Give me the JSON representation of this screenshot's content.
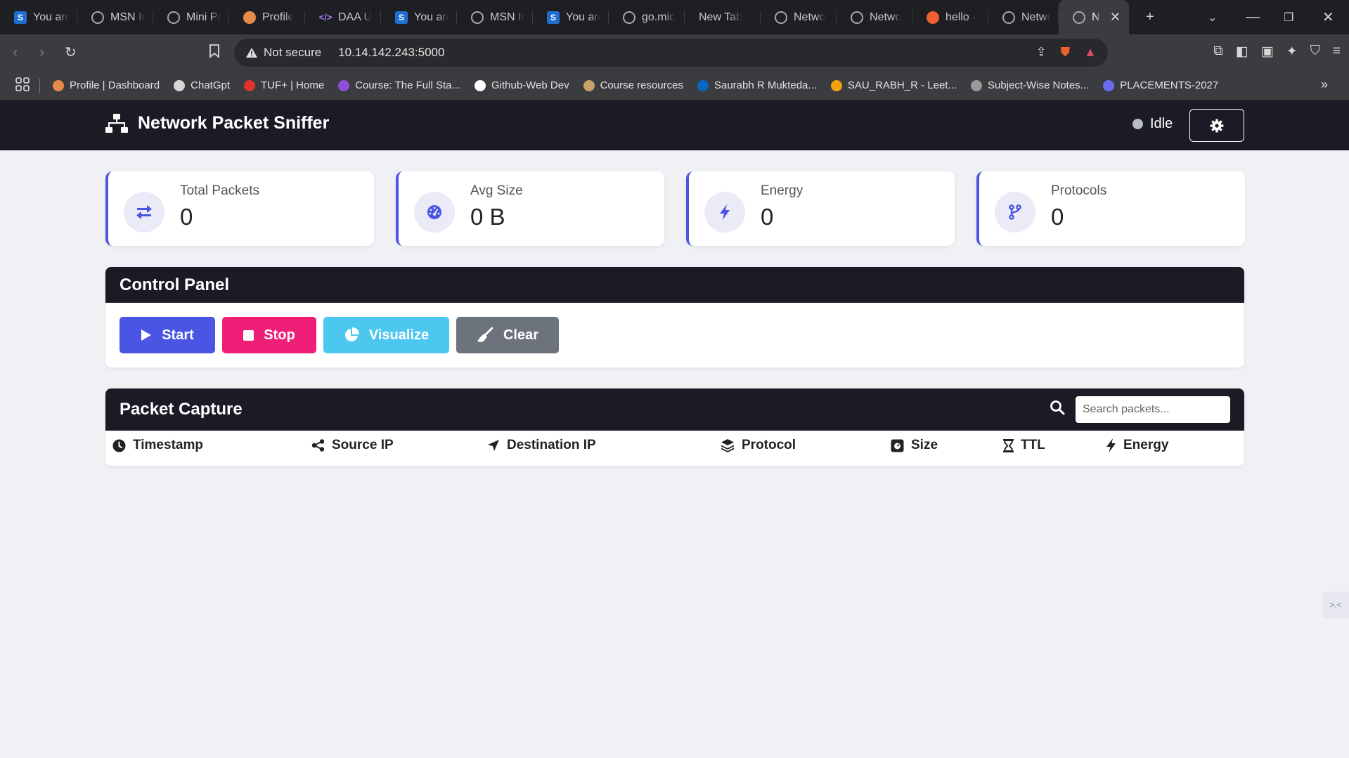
{
  "browser": {
    "tabs": [
      {
        "label": "You are",
        "icon": "s-logo-icon",
        "fav": "s",
        "glyph": "S",
        "w": 110
      },
      {
        "label": "MSN Ir",
        "icon": "globe-icon",
        "fav": "globe",
        "glyph": "",
        "w": 108
      },
      {
        "label": "Mini Pr",
        "icon": "openai-icon",
        "fav": "globe",
        "glyph": "",
        "w": 108
      },
      {
        "label": "Profile",
        "icon": "profile-icon",
        "fav": "orange",
        "glyph": "",
        "w": 108
      },
      {
        "label": "DAA U",
        "icon": "code-icon",
        "fav": "code",
        "glyph": "</>",
        "w": 108
      },
      {
        "label": "You are",
        "icon": "s-logo-icon",
        "fav": "s",
        "glyph": "S",
        "w": 108
      },
      {
        "label": "MSN Ir",
        "icon": "globe-icon",
        "fav": "globe",
        "glyph": "",
        "w": 108
      },
      {
        "label": "You are",
        "icon": "s-logo-icon",
        "fav": "s",
        "glyph": "S",
        "w": 108
      },
      {
        "label": "go.mic",
        "icon": "globe-icon",
        "fav": "globe",
        "glyph": "",
        "w": 108
      },
      {
        "label": "New Tab",
        "icon": "",
        "fav": "",
        "glyph": "",
        "w": 108
      },
      {
        "label": "Netwo",
        "icon": "globe-icon",
        "fav": "globe",
        "glyph": "",
        "w": 108
      },
      {
        "label": "Netwo",
        "icon": "globe-icon",
        "fav": "globe",
        "glyph": "",
        "w": 108
      },
      {
        "label": "hello -",
        "icon": "brave-icon",
        "fav": "brave",
        "glyph": "",
        "w": 108
      },
      {
        "label": "Netwo",
        "icon": "globe-icon",
        "fav": "globe",
        "glyph": "",
        "w": 100
      },
      {
        "label": "Ne",
        "icon": "globe-icon",
        "fav": "globe",
        "glyph": "",
        "w": 100,
        "active": true
      }
    ],
    "new_tab": "+",
    "security_label": "Not secure",
    "url": "10.14.142.243:5000",
    "bookmarks": [
      {
        "label": "Profile | Dashboard",
        "color": "#e88a4c"
      },
      {
        "label": "ChatGpt",
        "color": "#d6d6d6"
      },
      {
        "label": "TUF+ | Home",
        "color": "#e0312b"
      },
      {
        "label": "Course: The Full Sta...",
        "color": "#8f4fd6"
      },
      {
        "label": "Github-Web Dev",
        "color": "#ffffff"
      },
      {
        "label": "Course resources",
        "color": "#c9a16a"
      },
      {
        "label": "Saurabh R Mukteda...",
        "color": "#0a66c2"
      },
      {
        "label": "SAU_RABH_R - Leet...",
        "color": "#f0a30a"
      },
      {
        "label": "Subject-Wise Notes...",
        "color": "#9a9a9a"
      },
      {
        "label": "PLACEMENTS-2027",
        "color": "#6b6bf0"
      }
    ]
  },
  "app": {
    "title": "Network Packet Sniffer",
    "status": "Idle",
    "accent": "#4a55e3",
    "stats": [
      {
        "label": "Total Packets",
        "value": "0",
        "icon": "exchange-arrows-icon"
      },
      {
        "label": "Avg Size",
        "value": "0 B",
        "icon": "gauge-icon"
      },
      {
        "label": "Energy",
        "value": "0",
        "icon": "bolt-icon"
      },
      {
        "label": "Protocols",
        "value": "0",
        "icon": "code-branch-icon"
      }
    ],
    "control_panel": {
      "title": "Control Panel",
      "start": "Start",
      "stop": "Stop",
      "visualize": "Visualize",
      "clear": "Clear"
    },
    "packet_capture": {
      "title": "Packet Capture",
      "search_placeholder": "Search packets...",
      "columns": [
        "Timestamp",
        "Source IP",
        "Destination IP",
        "Protocol",
        "Size",
        "TTL",
        "Energy"
      ]
    }
  }
}
